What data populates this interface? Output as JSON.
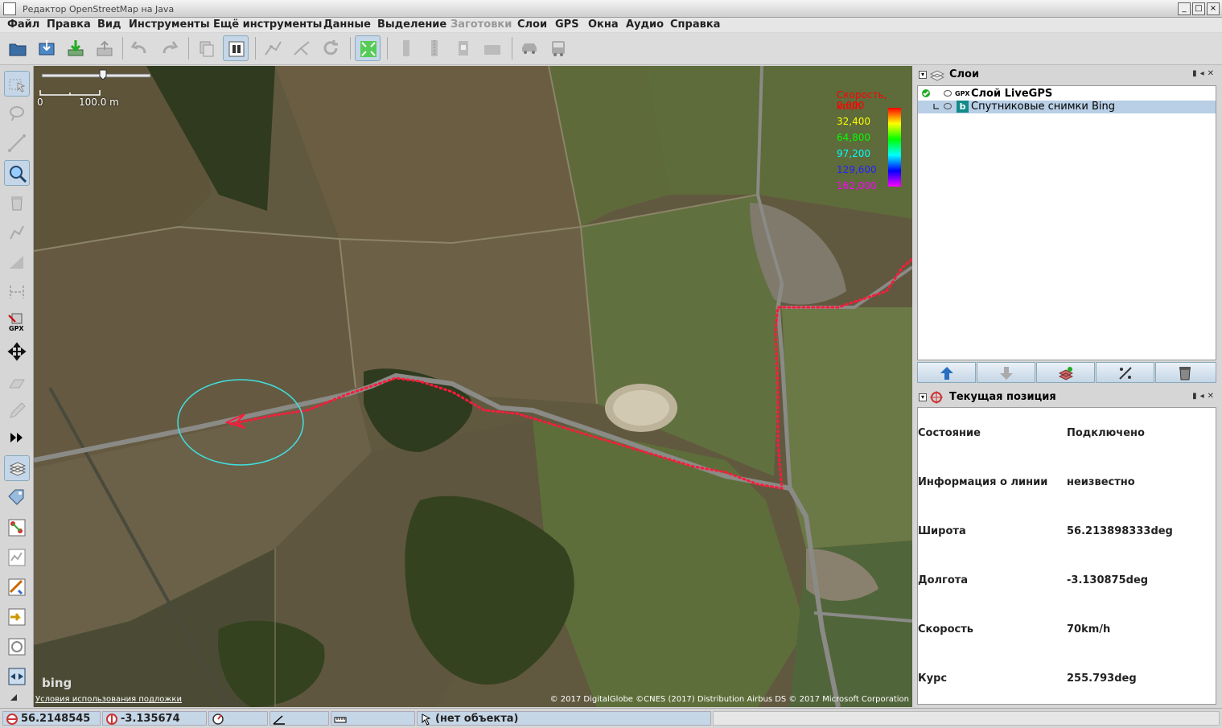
{
  "window": {
    "title": "Редактор OpenStreetMap на Java"
  },
  "menu": [
    {
      "label": "Файл",
      "disabled": false
    },
    {
      "label": "Правка",
      "disabled": false
    },
    {
      "label": "Вид",
      "disabled": false
    },
    {
      "label": "Инструменты",
      "disabled": false
    },
    {
      "label": "Ещё инструменты",
      "disabled": false
    },
    {
      "label": "Данные",
      "disabled": false
    },
    {
      "label": "Выделение",
      "disabled": false
    },
    {
      "label": "Заготовки",
      "disabled": true
    },
    {
      "label": "Слои",
      "disabled": false
    },
    {
      "label": "GPS",
      "disabled": false
    },
    {
      "label": "Окна",
      "disabled": false
    },
    {
      "label": "Аудио",
      "disabled": false
    },
    {
      "label": "Справка",
      "disabled": false
    }
  ],
  "map": {
    "scale": {
      "zero": "0",
      "distance": "100.0 m"
    },
    "speed_legend": {
      "title": "Скорость, km/h",
      "values": [
        "0,000",
        "32,400",
        "64,800",
        "97,200",
        "129,600",
        "162,000"
      ],
      "colors": [
        "#ff0000",
        "#ffff00",
        "#00ff00",
        "#00ffff",
        "#0000ff",
        "#ff00ff"
      ]
    },
    "imagery_logo": "bing",
    "terms_link": "Условия использования подложки",
    "copyright": "© 2017 DigitalGlobe ©CNES (2017) Distribution Airbus DS © 2017 Microsoft Corporation",
    "track_color": "#ff1a3c",
    "accuracy_circle_color": "#40e0e0"
  },
  "layers_panel": {
    "title": "Слои",
    "layers": [
      {
        "prefix": "GPX",
        "name": "Слой LiveGPS",
        "active": true,
        "selected": false
      },
      {
        "prefix": "b",
        "name": "Спутниковые снимки Bing",
        "active": false,
        "selected": true
      }
    ]
  },
  "position_panel": {
    "title": "Текущая позиция",
    "rows": [
      {
        "key": "Состояние",
        "value": "Подключено"
      },
      {
        "key": "Информация о линии",
        "value": "неизвестно"
      },
      {
        "key": "Широта",
        "value": "56.213898333deg"
      },
      {
        "key": "Долгота",
        "value": "-3.130875deg"
      },
      {
        "key": "Скорость",
        "value": "70km/h"
      },
      {
        "key": "Курс",
        "value": "255.793deg"
      }
    ]
  },
  "status": {
    "lat": "56.2148545",
    "lon": "-3.135674",
    "object": "(нет объекта)"
  }
}
